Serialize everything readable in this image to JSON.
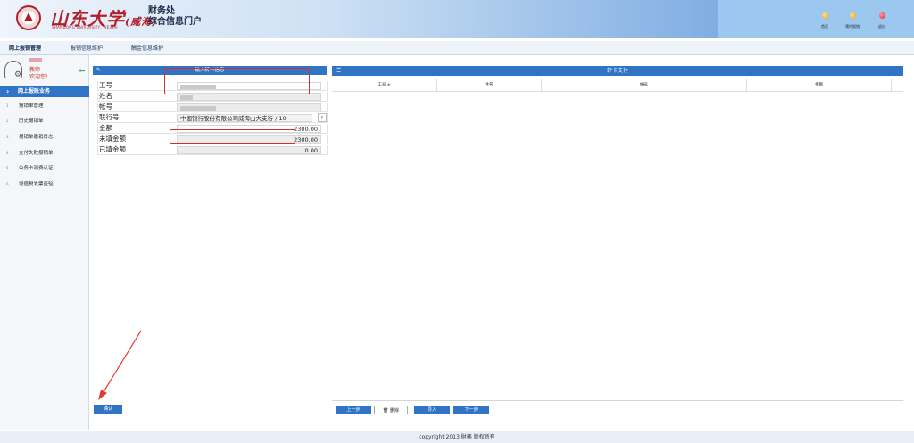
{
  "header": {
    "logo_text": "山东大学",
    "logo_branch": "(威海)",
    "logo_sub": "SHANDONG UNIVERSITY, WEIHAI",
    "dept_line1": "财务处",
    "dept_line2": "综合信息门户",
    "icons": [
      {
        "name": "home-icon",
        "label": "首页",
        "color": "#e8a317"
      },
      {
        "name": "appointment-icon",
        "label": "预约报销",
        "color": "#e8a317"
      },
      {
        "name": "logout-icon",
        "label": "退出",
        "color": "#d6262e"
      }
    ]
  },
  "topnav": {
    "tabs": [
      "网上报销管理",
      "报销信息维护",
      "酬金信息维护"
    ]
  },
  "sidebar": {
    "role": "教师",
    "welcome": "欢迎您!",
    "head": "网上报账业务",
    "items": [
      {
        "num": "1",
        "label": "报销单管理"
      },
      {
        "num": "2",
        "label": "历史报销单"
      },
      {
        "num": "3",
        "label": "报销单撤销日志"
      },
      {
        "num": "4",
        "label": "支付失败报销单"
      },
      {
        "num": "5",
        "label": "公务卡消费认证"
      },
      {
        "num": "6",
        "label": "增值税发票查验"
      }
    ]
  },
  "form": {
    "title": "输入转卡信息",
    "fields": {
      "employee_id_label": "工号",
      "name_label": "姓名",
      "account_label": "帐号",
      "bank_label": "联行号",
      "bank_value": "中国银行股份有限公司威海山大支行 / 10",
      "amount_label": "金额",
      "amount_value": "2300.00",
      "unfilled_label": "未填金额",
      "unfilled_value": "2300.00",
      "filled_label": "已填金额",
      "filled_value": "0.00"
    },
    "confirm_label": "确认"
  },
  "grid": {
    "title": "转卡支付",
    "columns": [
      "工号 ≑",
      "姓名",
      "帐号",
      "金额"
    ],
    "buttons": {
      "prev": "上一步",
      "delete": "删除",
      "import": "导入",
      "next": "下一步"
    }
  },
  "footer": {
    "text": "copyright 2013 財務 版权所有"
  },
  "colors": {
    "accent": "#2f74c5",
    "highlight": "#d32f2f"
  }
}
